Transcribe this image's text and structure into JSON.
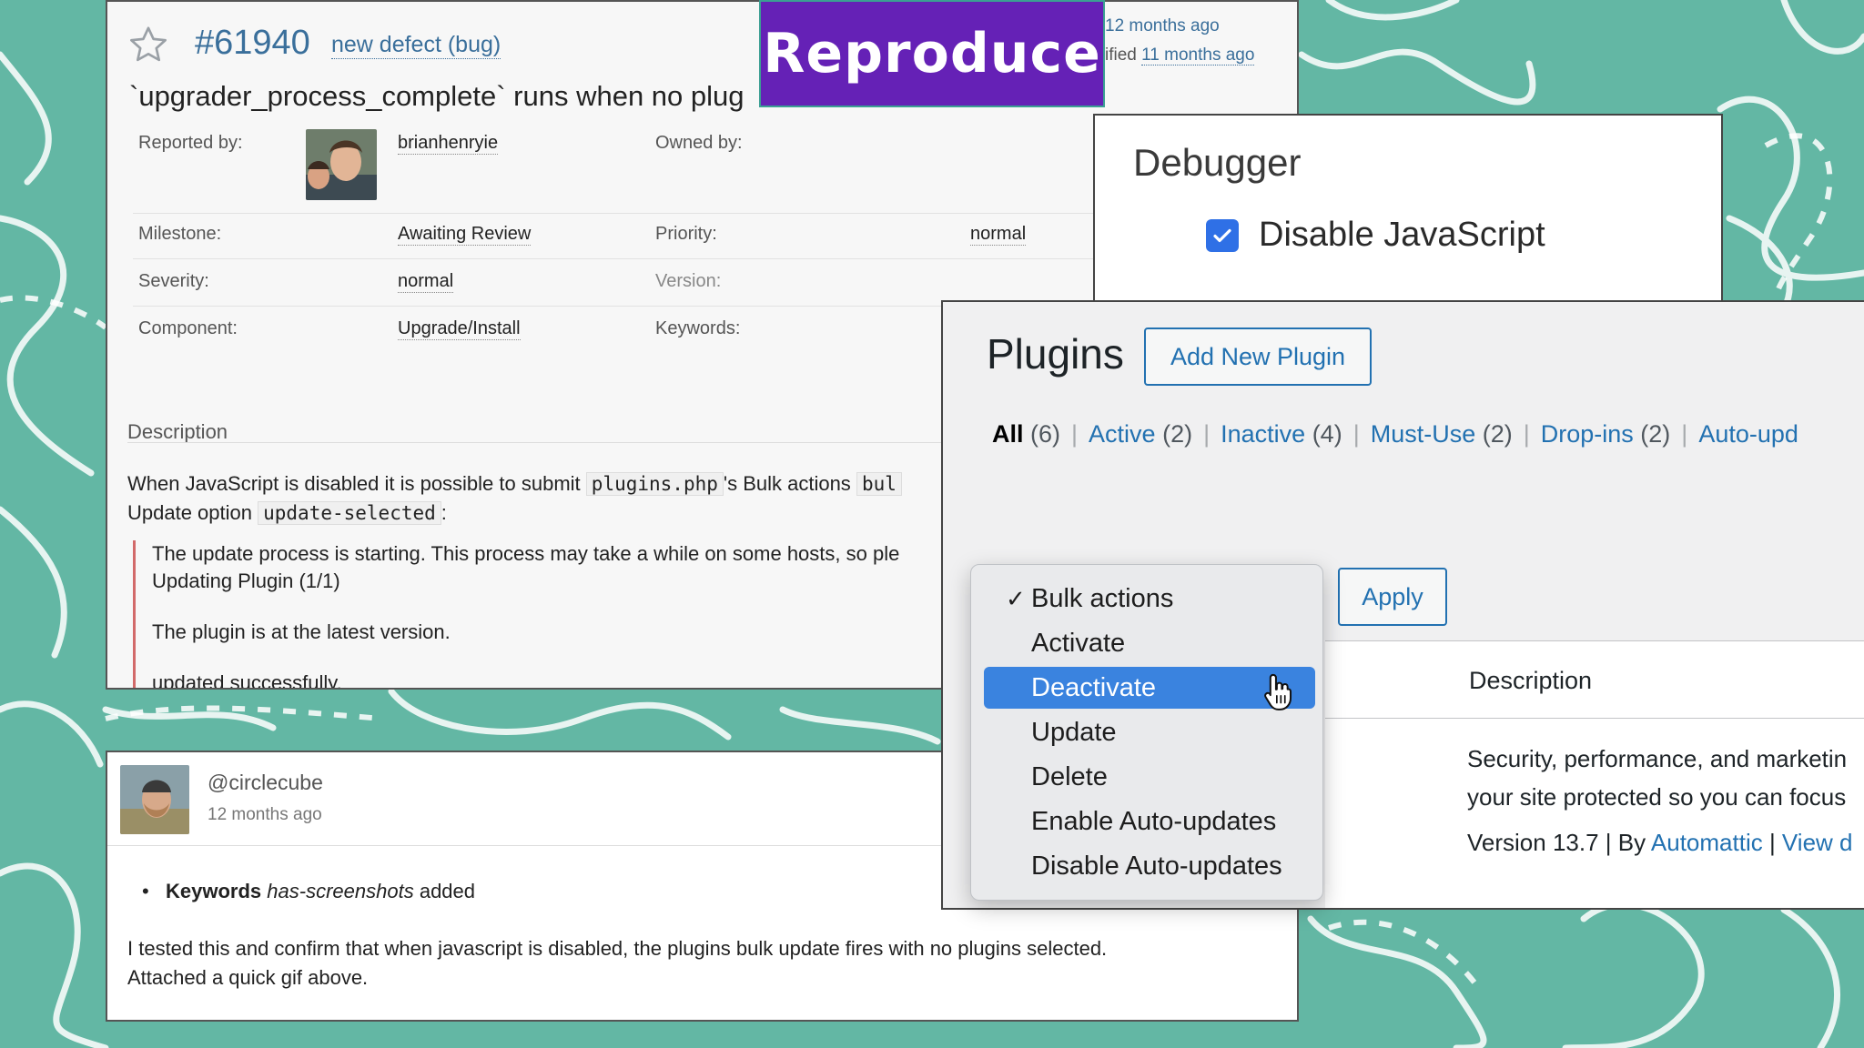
{
  "banner": {
    "label": "Reproduce"
  },
  "ticket": {
    "number": "#61940",
    "type": "new defect (bug)",
    "created": "12 months ago",
    "modified_prefix": "ified",
    "modified": "11 months ago",
    "summary": "`upgrader_process_complete` runs when no plug",
    "fields": {
      "reported_by_label": "Reported by:",
      "reported_by": "brianhenryie",
      "owned_by_label": "Owned by:",
      "milestone_label": "Milestone:",
      "milestone": "Awaiting Review",
      "priority_label": "Priority:",
      "priority": "normal",
      "severity_label": "Severity:",
      "severity": "normal",
      "version_label": "Version:",
      "component_label": "Component:",
      "component": "Upgrade/Install",
      "keywords_label": "Keywords:"
    },
    "description": {
      "heading": "Description",
      "line1_a": "When JavaScript is disabled it is possible to submit",
      "line1_code": "plugins.php",
      "line1_b": "'s Bulk actions",
      "line1_code2": "bul",
      "line2_a": "Update option",
      "line2_code": "update-selected",
      "line2_b": ":",
      "quote": [
        "The update process is starting. This process may take a while on some hosts, so ple",
        "Updating Plugin (1/1)",
        "",
        "The plugin is at the latest version.",
        "",
        "updated successfully."
      ]
    }
  },
  "comment": {
    "author": "@circlecube",
    "time": "12 months ago",
    "change_field": "Keywords",
    "change_value": "has-screenshots",
    "change_action": "added",
    "body_line1": "I tested this and confirm that when javascript is disabled, the plugins bulk update fires with no plugins selected.",
    "body_line2": "Attached a quick gif above."
  },
  "debugger": {
    "title": "Debugger",
    "option_label": "Disable JavaScript",
    "option_checked": true
  },
  "plugins": {
    "title": "Plugins",
    "add_new": "Add New Plugin",
    "filters": [
      {
        "label": "All",
        "count": "(6)"
      },
      {
        "label": "Active",
        "count": "(2)"
      },
      {
        "label": "Inactive",
        "count": "(4)"
      },
      {
        "label": "Must-Use",
        "count": "(2)"
      },
      {
        "label": "Drop-ins",
        "count": "(2)"
      },
      {
        "label": "Auto-upd",
        "count": ""
      }
    ],
    "apply": "Apply",
    "col_description": "Description",
    "plugin_desc_line1": "Security, performance, and marketin",
    "plugin_desc_line2": "your site protected so you can focus",
    "version_text": "Version 13.7 | By ",
    "author_link": "Automattic",
    "sep": " | ",
    "view_link": "View d"
  },
  "bulk_actions": {
    "options": [
      {
        "label": "Bulk actions",
        "checked": true
      },
      {
        "label": "Activate"
      },
      {
        "label": "Deactivate",
        "highlighted": true
      },
      {
        "label": "Update"
      },
      {
        "label": "Delete"
      },
      {
        "label": "Enable Auto-updates"
      },
      {
        "label": "Disable Auto-updates"
      }
    ],
    "check_glyph": "✓"
  },
  "colors": {
    "background": "#63b7a4",
    "banner": "#6521b6",
    "wp_blue": "#2271b1",
    "trac_link": "#3a6f9b",
    "highlight": "#3a83df"
  }
}
